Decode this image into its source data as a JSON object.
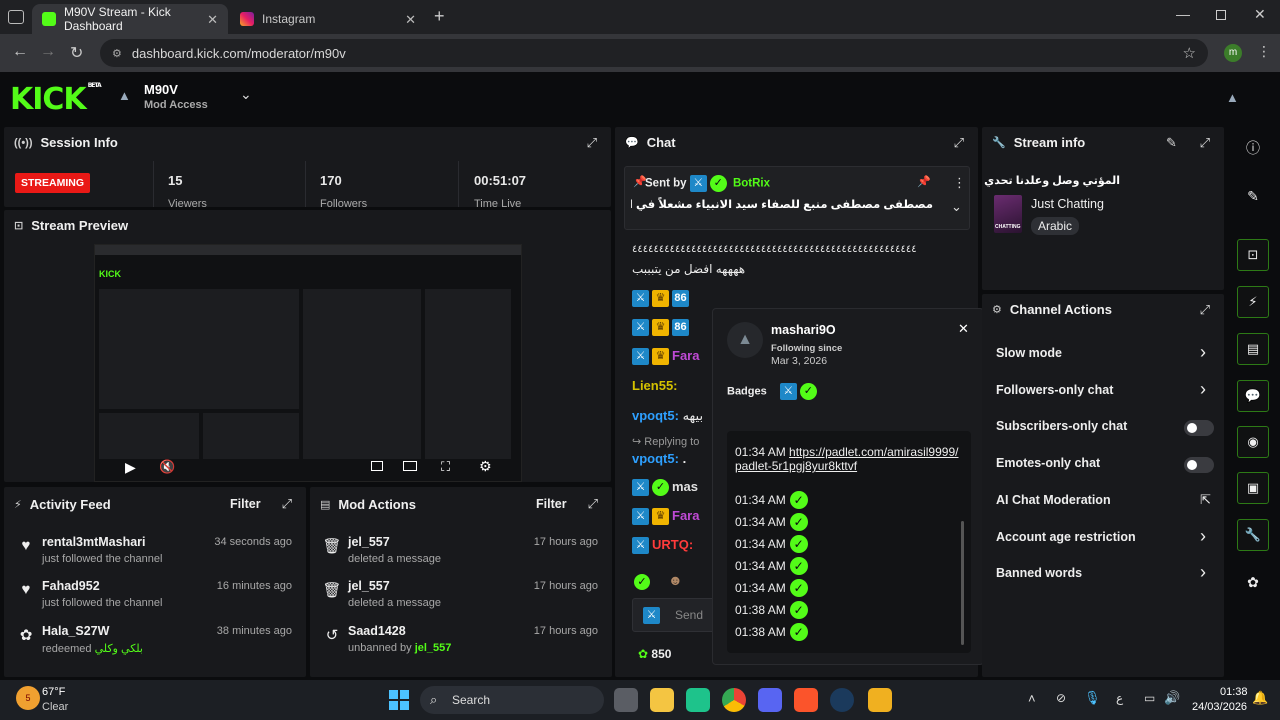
{
  "browser": {
    "tabs": [
      {
        "title": "M90V Stream - Kick Dashboard",
        "active": true
      },
      {
        "title": "Instagram",
        "active": false
      }
    ],
    "url": "dashboard.kick.com/moderator/m90v",
    "profile_initial": "m"
  },
  "header": {
    "logo": "KICK",
    "logo_tag": "BETA",
    "channel_name": "M90V",
    "role": "Mod Access"
  },
  "session": {
    "title": "Session Info",
    "status": "STREAMING",
    "viewers": "15",
    "viewers_label": "Viewers",
    "followers": "170",
    "followers_label": "Followers",
    "time_live": "00:51:07",
    "time_label": "Time Live"
  },
  "preview": {
    "title": "Stream Preview"
  },
  "activity": {
    "title": "Activity Feed",
    "filter": "Filter",
    "items": [
      {
        "name": "rental3mtMashari",
        "sub": "just followed the channel",
        "time": "34 seconds ago",
        "icon": "heart-icon"
      },
      {
        "name": "Fahad952",
        "sub": "just followed the channel",
        "time": "16 minutes ago",
        "icon": "heart-icon"
      },
      {
        "name": "Hala_S27W",
        "sub": "redeemed",
        "reward": "بلكي وكلي",
        "time": "38 minutes ago",
        "icon": "points-icon"
      }
    ]
  },
  "modactions": {
    "title": "Mod Actions",
    "filter": "Filter",
    "items": [
      {
        "name": "jel_557",
        "sub": "deleted a message",
        "time": "17 hours ago",
        "icon": "trash-icon"
      },
      {
        "name": "jel_557",
        "sub": "deleted a message",
        "time": "17 hours ago",
        "icon": "trash-icon"
      },
      {
        "name": "Saad1428",
        "sub": "unbanned by",
        "by": "jel_557",
        "time": "17 hours ago",
        "icon": "undo-icon"
      }
    ]
  },
  "chat": {
    "title": "Chat",
    "pinned": {
      "sent_by_label": "Sent by",
      "sender": "BotRix",
      "message": "مصطفى مصطفى منبع للصفاء سيد الانبياء مشعلاً في الوفاء كان في عطفيهي"
    },
    "lines": [
      {
        "text": "٤٤٤٤٤٤٤٤٤٤٤٤٤٤٤٤٤٤٤٤٤٤٤٤٤٤٤٤٤٤٤٤٤٤٤٤٤٤٤٤٤٤٤٤٤٤٤٤٤٤٤٤٤"
      },
      {
        "text": "ههههه افضل من يتبببب"
      }
    ],
    "users": [
      {
        "name": "Fara",
        "color": "#c04ad6"
      },
      {
        "name": "Lien55:",
        "color": "#d4c200"
      },
      {
        "name": "vpoqt5:",
        "color": "#2ea0ff",
        "text": "بيهه"
      },
      {
        "name": "vpoqt5:",
        "color": "#2ea0ff",
        "text": "."
      },
      {
        "name": "mas",
        "color": "#e0e0e0"
      },
      {
        "name": "Fara",
        "color": "#c04ad6"
      },
      {
        "name": "URTQ:",
        "color": "#ff3b3b"
      }
    ],
    "replying_to": "Replying to",
    "send_placeholder": "Send",
    "points": "850"
  },
  "user_card": {
    "username": "mashari9O",
    "following_label": "Following since",
    "following_date": "Mar 3, 2026",
    "badges_label": "Badges",
    "messages": [
      {
        "time": "01:34 AM",
        "link": "https://padlet.com/amirasil9999/padlet-5r1pgj8yur8kttvf"
      },
      {
        "time": "01:34 AM"
      },
      {
        "time": "01:34 AM"
      },
      {
        "time": "01:34 AM"
      },
      {
        "time": "01:34 AM"
      },
      {
        "time": "01:34 AM"
      },
      {
        "time": "01:38 AM"
      },
      {
        "time": "01:38 AM"
      }
    ]
  },
  "stream_info": {
    "title": "Stream info",
    "stream_title": "المؤتي وصل وعلدنا تحدي اليوم",
    "category": "Just Chatting",
    "category_thumb": "CHATTING",
    "language": "Arabic"
  },
  "channel_actions": {
    "title": "Channel Actions",
    "items": [
      {
        "label": "Slow mode",
        "control": "chevron"
      },
      {
        "label": "Followers-only chat",
        "control": "chevron"
      },
      {
        "label": "Subscribers-only chat",
        "control": "toggle"
      },
      {
        "label": "Emotes-only chat",
        "control": "toggle"
      },
      {
        "label": "AI Chat Moderation",
        "control": "external"
      },
      {
        "label": "Account age restriction",
        "control": "chevron"
      },
      {
        "label": "Banned words",
        "control": "chevron"
      }
    ]
  },
  "taskbar": {
    "weather_temp": "67°F",
    "weather_desc": "Clear",
    "search": "Search",
    "time": "01:38",
    "date": "24/03/2026",
    "lang": "ع"
  },
  "colors": {
    "accent": "#53fc18",
    "streaming": "#e91916",
    "panel": "#18191c",
    "bg": "#0b0c0e"
  }
}
